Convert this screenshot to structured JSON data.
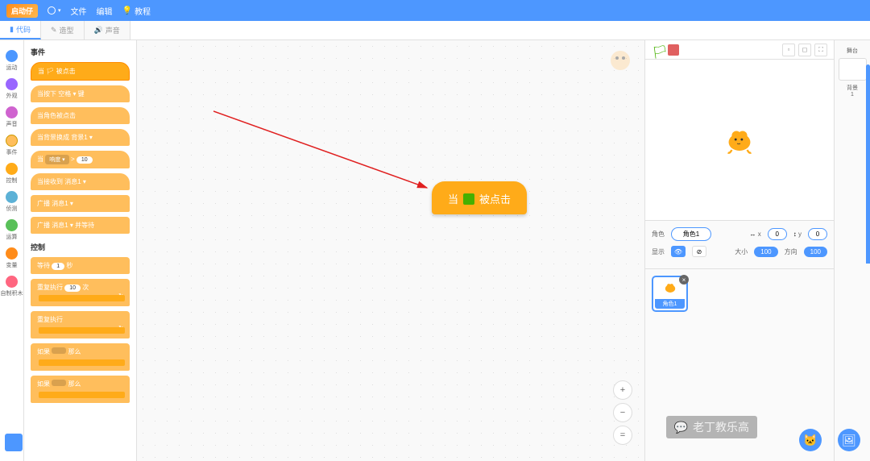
{
  "menubar": {
    "logo": "启动仔",
    "file": "文件",
    "edit": "编辑",
    "tutorials": "教程"
  },
  "tabs": {
    "code": "代码",
    "costumes": "造型",
    "sounds": "声音"
  },
  "categories": [
    {
      "label": "运动",
      "color": "#4c97ff"
    },
    {
      "label": "外观",
      "color": "#9966ff"
    },
    {
      "label": "声音",
      "color": "#cf63cf"
    },
    {
      "label": "事件",
      "color": "#ffbe5c"
    },
    {
      "label": "控制",
      "color": "#ffab19"
    },
    {
      "label": "侦测",
      "color": "#5cb1d6"
    },
    {
      "label": "运算",
      "color": "#59c059"
    },
    {
      "label": "变量",
      "color": "#ff8c1a"
    },
    {
      "label": "自制积木",
      "color": "#ff6680"
    }
  ],
  "palette": {
    "section1": "事件",
    "section2": "控制",
    "blocks": {
      "when_flag": "当 🏳 被点击",
      "when_key": "当按下 空格 ▾ 键",
      "when_sprite": "当角色被点击",
      "when_backdrop": "当背景换成 背景1 ▾",
      "when_loudness_prefix": "当",
      "when_loudness_menu": "响度 ▾",
      "when_loudness_op": ">",
      "when_loudness_val": "10",
      "when_receive": "当接收到 消息1 ▾",
      "broadcast": "广播 消息1 ▾",
      "broadcast_wait": "广播 消息1 ▾ 并等待",
      "wait_prefix": "等待",
      "wait_val": "1",
      "wait_suffix": "秒",
      "repeat_prefix": "重复执行",
      "repeat_val": "10",
      "repeat_suffix": "次",
      "forever": "重复执行",
      "if_prefix": "如果",
      "if_suffix": "那么"
    }
  },
  "canvas_block": {
    "prefix": "当",
    "suffix": "被点击"
  },
  "sprite_info": {
    "name_label": "角色",
    "name_value": "角色1",
    "x_label": "x",
    "x_value": "0",
    "y_label": "y",
    "y_value": "0",
    "show_label": "显示",
    "size_label": "大小",
    "size_value": "100",
    "direction_label": "方向",
    "direction_value": "100"
  },
  "stage_col": {
    "stage_label": "舞台",
    "backdrop_label": "背景",
    "backdrop_count": "1"
  },
  "watermark_text": "老丁教乐高"
}
